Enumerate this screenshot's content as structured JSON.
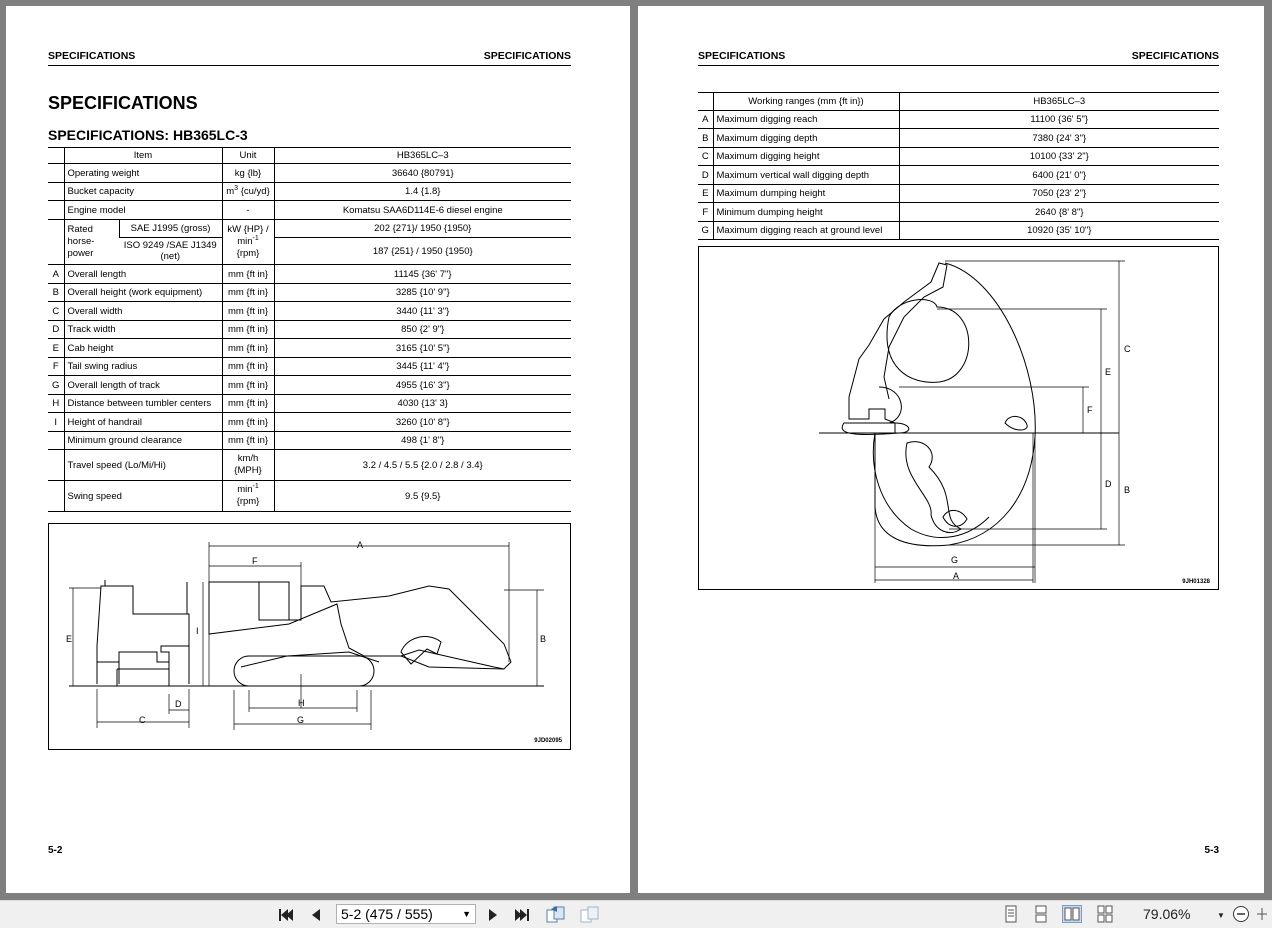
{
  "left_page": {
    "header_left": "SPECIFICATIONS",
    "header_right": "SPECIFICATIONS",
    "title": "SPECIFICATIONS",
    "subtitle": "SPECIFICATIONS: HB365LC-3",
    "table_header": {
      "item": "Item",
      "unit": "Unit",
      "model": "HB365LC–3"
    },
    "rows": [
      {
        "letter": "",
        "item": "Operating weight",
        "unit": "kg {lb}",
        "value": "36640 {80791}"
      },
      {
        "letter": "",
        "item": "Bucket capacity",
        "unit_main": "m",
        "unit_sup": "3",
        "unit_rest": " {cu/yd}",
        "value": "1.4 {1.8}"
      },
      {
        "letter": "",
        "item": "Engine model",
        "unit": "-",
        "value": "Komatsu SAA6D114E-6 diesel engine"
      }
    ],
    "power": {
      "group_label": "Rated horse-power",
      "sub1": "SAE J1995 (gross)",
      "sub2": "ISO 9249 /SAE J1349 (net)",
      "unit_l1": "kW {HP} /",
      "unit_l2": "min",
      "unit_sup": "-1",
      "unit_l3": "{rpm}",
      "value1": "202 {271}/ 1950 {1950}",
      "value2": "187 {251} / 1950 {1950}"
    },
    "dim_rows": [
      {
        "letter": "A",
        "item": "Overall length",
        "unit": "mm {ft in}",
        "value": "11145 {36' 7\"}"
      },
      {
        "letter": "B",
        "item": "Overall height (work equipment)",
        "unit": "mm {ft in}",
        "value": "3285 {10' 9\"}"
      },
      {
        "letter": "C",
        "item": "Overall width",
        "unit": "mm {ft in}",
        "value": "3440 {11' 3\"}"
      },
      {
        "letter": "D",
        "item": "Track width",
        "unit": "mm {ft in}",
        "value": "850 {2' 9\"}"
      },
      {
        "letter": "E",
        "item": "Cab height",
        "unit": "mm {ft in}",
        "value": "3165 {10' 5\"}"
      },
      {
        "letter": "F",
        "item": "Tail swing radius",
        "unit": "mm {ft in}",
        "value": "3445 {11' 4\"}"
      },
      {
        "letter": "G",
        "item": "Overall length of track",
        "unit": "mm {ft in}",
        "value": "4955 {16' 3\"}"
      },
      {
        "letter": "H",
        "item": "Distance between tumbler centers",
        "unit": "mm {ft in}",
        "value": "4030 {13' 3}"
      },
      {
        "letter": "I",
        "item": "Height of handrail",
        "unit": "mm {ft in}",
        "value": "3260 {10' 8\"}"
      },
      {
        "letter": "",
        "item": "Minimum ground clearance",
        "unit": "mm {ft in}",
        "value": "498 {1' 8\"}"
      }
    ],
    "travel": {
      "item": "Travel speed (Lo/Mi/Hi)",
      "unit_l1": "km/h",
      "unit_l2": "{MPH}",
      "value": "3.2 / 4.5 / 5.5 {2.0 / 2.8 / 3.4}"
    },
    "swing": {
      "item": "Swing speed",
      "unit_l1": "min",
      "unit_sup": "-1",
      "unit_l2": "{rpm}",
      "value": "9.5 {9.5}"
    },
    "figure_labels": {
      "A": "A",
      "B": "B",
      "C": "C",
      "D": "D",
      "E": "E",
      "F": "F",
      "G": "G",
      "H": "H",
      "I": "I"
    },
    "figure_code": "9JD02095",
    "page_number": "5-2"
  },
  "right_page": {
    "header_left": "SPECIFICATIONS",
    "header_right": "SPECIFICATIONS",
    "table_header": {
      "item": "Working ranges (mm {ft in})",
      "model": "HB365LC–3"
    },
    "rows": [
      {
        "letter": "A",
        "item": "Maximum digging reach",
        "value": "11100 {36' 5\"}"
      },
      {
        "letter": "B",
        "item": "Maximum digging depth",
        "value": "7380 {24' 3\"}"
      },
      {
        "letter": "C",
        "item": "Maximum digging height",
        "value": "10100 {33' 2\"}"
      },
      {
        "letter": "D",
        "item": "Maximum vertical wall digging depth",
        "value": "6400 {21' 0\"}"
      },
      {
        "letter": "E",
        "item": "Maximum dumping height",
        "value": "7050 {23' 2\"}"
      },
      {
        "letter": "F",
        "item": "Minimum dumping height",
        "value": "2640 {8' 8\"}"
      },
      {
        "letter": "G",
        "item": "Maximum digging reach at ground level",
        "value": "10920 {35' 10\"}"
      }
    ],
    "figure_labels": {
      "A": "A",
      "B": "B",
      "C": "C",
      "D": "D",
      "E": "E",
      "F": "F",
      "G": "G"
    },
    "figure_code": "9JH01328",
    "page_number": "5-3"
  },
  "toolbar": {
    "page_field": "5-2 (475 / 555)",
    "zoom": "79.06%",
    "colors": {
      "background": "#f0f0f0",
      "viewer": "#7f7f7f",
      "active_view": "#c9d9ef"
    }
  }
}
